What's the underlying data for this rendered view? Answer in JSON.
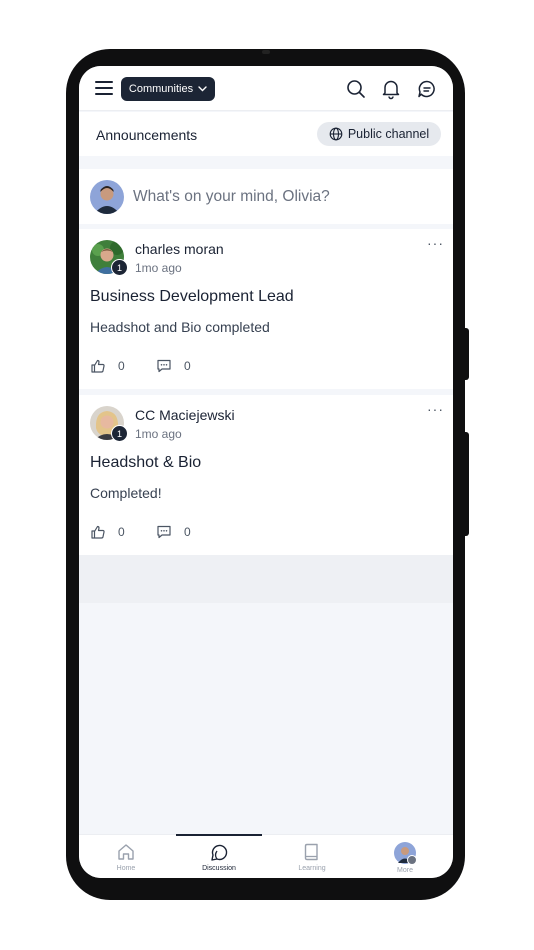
{
  "topbar": {
    "communities_label": "Communities",
    "icons": [
      "menu-icon",
      "search-icon",
      "bell-icon",
      "chat-icon"
    ]
  },
  "channel": {
    "title": "Announcements",
    "visibility_label": "Public channel"
  },
  "composer": {
    "placeholder": "What's on your mind, Olivia?"
  },
  "posts": [
    {
      "author": "charles moran",
      "time": "1mo ago",
      "badge": "1",
      "title": "Business Development Lead",
      "body": "Headshot and Bio completed",
      "likes": "0",
      "comments": "0",
      "more": "···"
    },
    {
      "author": "CC Maciejewski",
      "time": "1mo ago",
      "badge": "1",
      "title": "Headshot & Bio",
      "body": "Completed!",
      "likes": "0",
      "comments": "0",
      "more": "···"
    }
  ],
  "bottom_nav": {
    "items": [
      {
        "label": "Home",
        "icon": "home-icon"
      },
      {
        "label": "Discussion",
        "icon": "discussion-icon",
        "active": true
      },
      {
        "label": "Learning",
        "icon": "book-icon"
      },
      {
        "label": "More",
        "icon": "avatar"
      }
    ]
  },
  "colors": {
    "primary": "#1c2535",
    "background": "#f4f6fa",
    "muted_text": "#6b7280"
  }
}
